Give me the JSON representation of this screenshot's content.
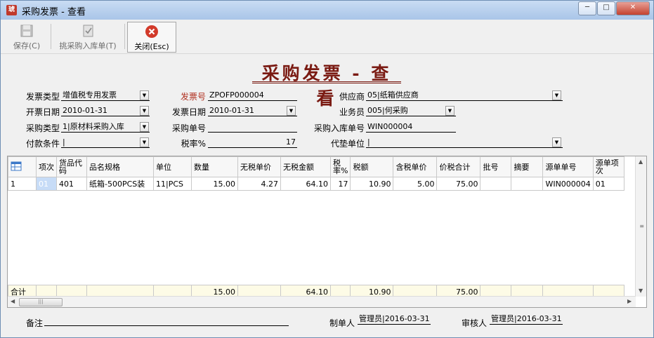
{
  "window": {
    "title": "采购发票 - 查看",
    "app_icon_text": "琥",
    "minimize_icon": "minimize-icon",
    "maximize_icon": "maximize-icon",
    "close_icon": "close-icon"
  },
  "toolbar": {
    "save_label": "保存(C)",
    "pick_label": "挑采购入库单(T)",
    "close_label": "关闭(Esc)"
  },
  "form": {
    "title": "采购发票 - 查看",
    "invoice_type_label": "发票类型",
    "invoice_type_value": "增值税专用发票",
    "invoice_no_label": "发票号",
    "invoice_no_value": "ZPOFP000004",
    "supplier_label": "供应商",
    "supplier_value": "05|纸箱供应商",
    "bill_date_label": "开票日期",
    "bill_date_value": "2010-01-31",
    "invoice_date_label": "发票日期",
    "invoice_date_value": "2010-01-31",
    "salesman_label": "业务员",
    "salesman_value": "005|何采购",
    "purchase_type_label": "采购类型",
    "purchase_type_value": "1|原材料采购入库",
    "purchase_order_label": "采购单号",
    "purchase_order_value": "",
    "receipt_no_label": "采购入库单号",
    "receipt_no_value": "WIN000004",
    "payment_terms_label": "付款条件",
    "payment_terms_value": "|",
    "tax_rate_label": "税率%",
    "tax_rate_value": "17",
    "advance_unit_label": "代垫单位",
    "advance_unit_value": "|"
  },
  "grid": {
    "headers": [
      "项次",
      "货品代码",
      "品名规格",
      "单位",
      "数量",
      "无税单价",
      "无税金额",
      "税率%",
      "税额",
      "含税单价",
      "价税合计",
      "批号",
      "摘要",
      "源单单号",
      "源单项次"
    ],
    "rows": [
      {
        "rownum": "1",
        "cells": [
          "01",
          "401",
          "纸箱-500PCS装",
          "11|PCS",
          "15.00",
          "4.27",
          "64.10",
          "17",
          "10.90",
          "5.00",
          "75.00",
          "",
          "",
          "WIN000004",
          "01"
        ]
      }
    ],
    "total_label": "合计",
    "totals": {
      "quantity": "15.00",
      "amount": "64.10",
      "tax": "10.90",
      "total": "75.00"
    }
  },
  "footer": {
    "remark_label": "备注",
    "remark_value": "",
    "maker_label": "制单人",
    "maker_value": "管理员|2016-03-31",
    "auditor_label": "审核人",
    "auditor_value": "管理员|2016-03-31"
  }
}
